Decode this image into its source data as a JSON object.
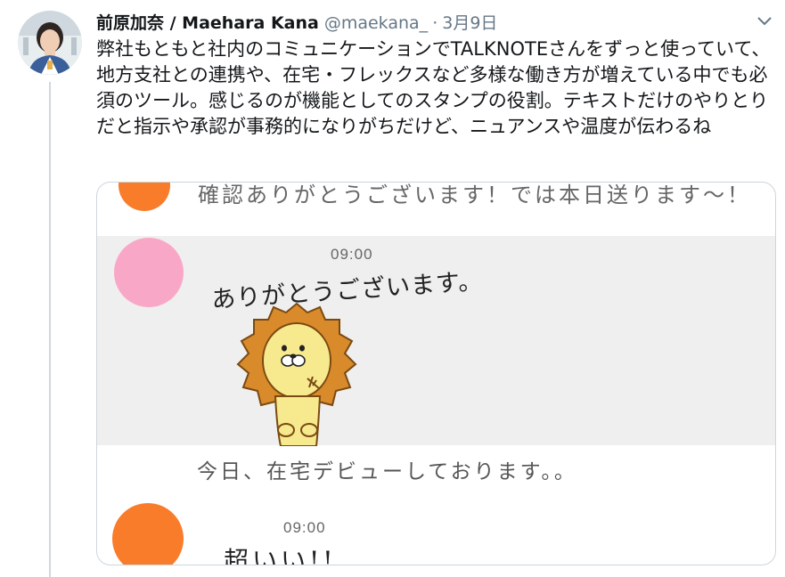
{
  "tweet": {
    "display_name": "前原加奈 / Maehara Kana",
    "handle": "@maekana_",
    "separator": "·",
    "date": "3月9日",
    "text": "弊社もともと社内のコミュニケーションでTALKNOTEさんをずっと使っていて、地方支社との連携や、在宅・フレックスなど多様な働き方が増えている中でも必須のツール。感じるのが機能としてのスタンプの役割。テキストだけのやりとりだと指示や承認が事務的になりがちだけど、ニュアンスや温度が伝わるね"
  },
  "media": {
    "message_top": "確認ありがとうございます！では本日送ります～！",
    "time_1": "09:00",
    "sticker_text": "ありがとうございます。",
    "message_mid": "今日、在宅デビューしております。。",
    "time_2": "09:00",
    "handwriting_2": "超いい!!"
  },
  "colors": {
    "orange_avatar": "#f97c2a",
    "pink_avatar": "#f8a8c6",
    "gray_band": "#efefef",
    "handle_gray": "#657786"
  },
  "icons": {
    "caret": "chevron-down-icon",
    "sticker": "lion-sticker-icon"
  }
}
